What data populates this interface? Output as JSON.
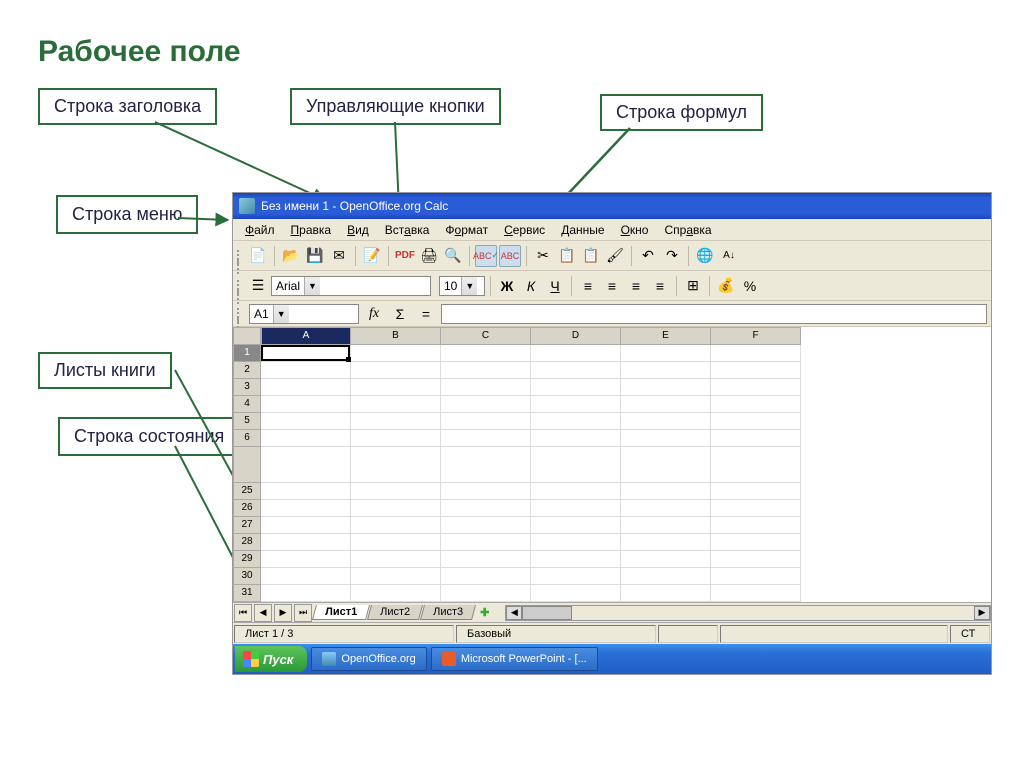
{
  "slide": {
    "title": "Рабочее поле",
    "labels": {
      "titlebar": "Строка заголовка",
      "controlButtons": "Управляющие кнопки",
      "formulaBar": "Строка формул",
      "menuBar": "Строка меню",
      "sheets": "Листы книги",
      "statusBar": "Строка состояния"
    }
  },
  "app": {
    "title": "Без имени 1 - OpenOffice.org Calc",
    "menu": [
      "Файл",
      "Правка",
      "Вид",
      "Вставка",
      "Формат",
      "Сервис",
      "Данные",
      "Окно",
      "Справка"
    ],
    "font": {
      "name": "Arial",
      "size": "10"
    },
    "namebox": "A1",
    "columns": [
      "A",
      "B",
      "C",
      "D",
      "E",
      "F"
    ],
    "rows": [
      1,
      2,
      3,
      4,
      5,
      6,
      25,
      26,
      27,
      28,
      29,
      30,
      31
    ],
    "selectedCell": "A1",
    "tabs": [
      "Лист1",
      "Лист2",
      "Лист3"
    ],
    "activeTab": 0,
    "status": {
      "sheet": "Лист 1 / 3",
      "mode": "Базовый",
      "right": "СТ"
    },
    "taskbar": {
      "start": "Пуск",
      "tasks": [
        "OpenOffice.org",
        "Microsoft PowerPoint - [..."
      ]
    },
    "icons": {
      "fx": "fx",
      "sigma": "Σ",
      "equals": "=",
      "bold": "Ж",
      "italic": "К",
      "underline": "Ч",
      "percent": "%"
    }
  }
}
